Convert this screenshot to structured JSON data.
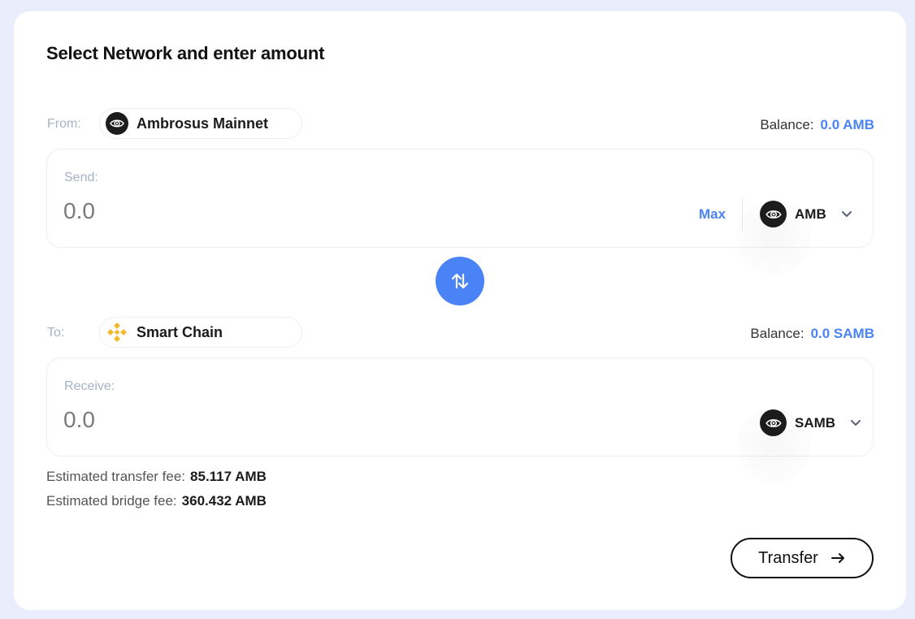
{
  "title": "Select Network and enter amount",
  "from": {
    "label": "From:",
    "network": "Ambrosus Mainnet",
    "network_icon": "ambrosus-eye-icon",
    "balance_label": "Balance:",
    "balance_value": "0.0 AMB"
  },
  "send": {
    "label": "Send:",
    "amount": "0.0",
    "max_label": "Max",
    "token": "AMB",
    "token_icon": "ambrosus-eye-icon"
  },
  "swap": {
    "icon": "swap-arrows-icon"
  },
  "to": {
    "label": "To:",
    "network": "Smart Chain",
    "network_icon": "binance-icon",
    "balance_label": "Balance:",
    "balance_value": "0.0 SAMB"
  },
  "receive": {
    "label": "Receive:",
    "amount": "0.0",
    "token": "SAMB",
    "token_icon": "ambrosus-eye-icon"
  },
  "fees": {
    "transfer_label": "Estimated transfer fee:",
    "transfer_value": "85.117 AMB",
    "bridge_label": "Estimated bridge fee:",
    "bridge_value": "360.432 AMB"
  },
  "transfer_button": {
    "label": "Transfer"
  },
  "colors": {
    "accent": "#4a83f5",
    "background": "#e9edfc",
    "binance": "#f3ba2f"
  }
}
